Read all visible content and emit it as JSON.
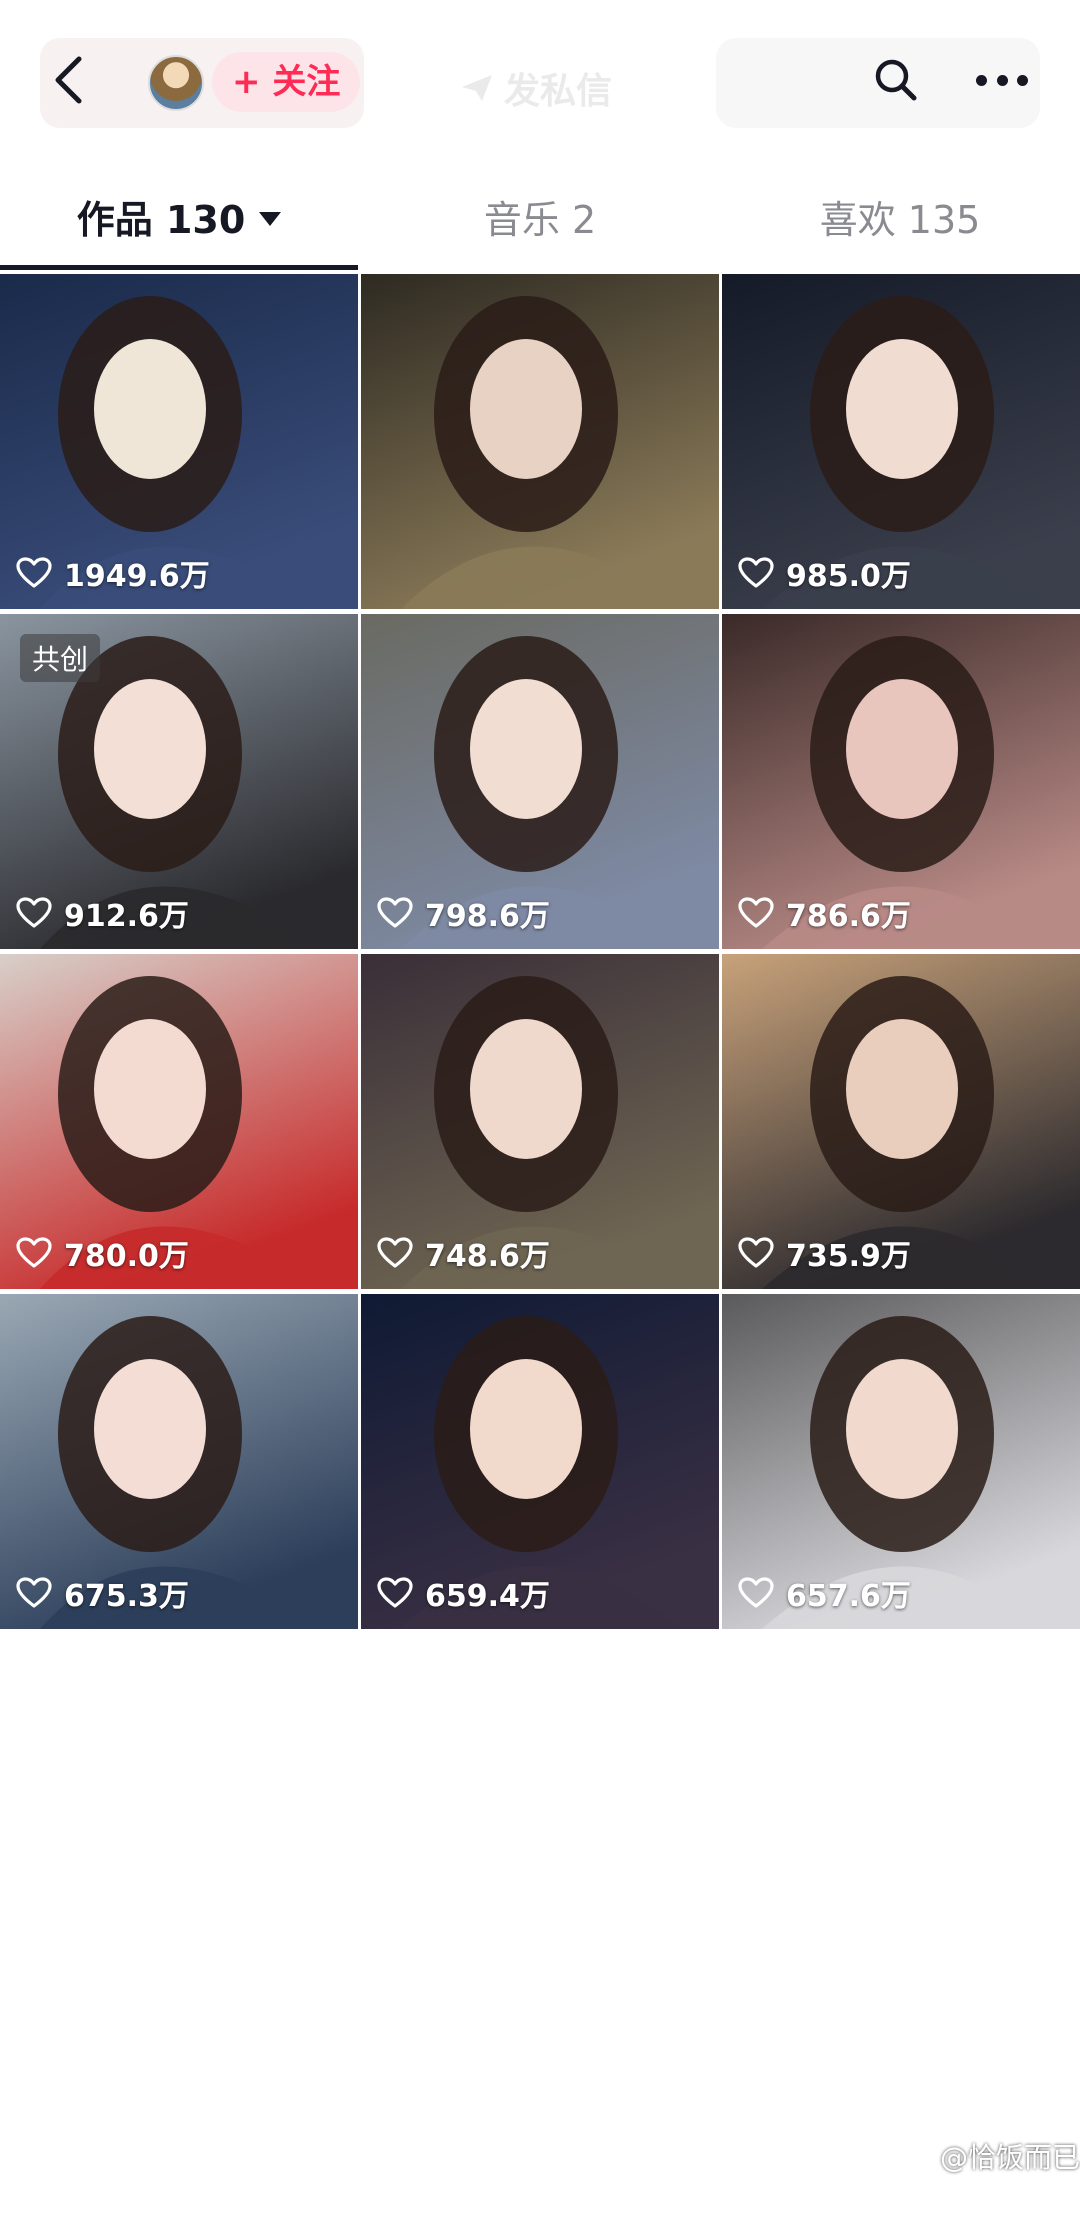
{
  "header": {
    "follow_label": "+ 关注",
    "dm_label": "发私信",
    "icons": [
      "back-arrow-icon",
      "search-icon",
      "more-icon"
    ]
  },
  "tabs": [
    {
      "label": "作品 130",
      "active": true
    },
    {
      "label": "音乐 2",
      "active": false
    },
    {
      "label": "喜欢 135",
      "active": false
    }
  ],
  "videos": [
    {
      "likes": "1949.6万",
      "palette": [
        "#1a2a4a",
        "#3a4d7a",
        "#f0e6d8"
      ]
    },
    {
      "likes": "",
      "palette": [
        "#2e2a22",
        "#8a7a58",
        "#e8d2c4"
      ]
    },
    {
      "likes": "985.0万",
      "palette": [
        "#151a28",
        "#3b3f4c",
        "#f1dcd2"
      ]
    },
    {
      "likes": "912.6万",
      "badge": "共创",
      "palette": [
        "#8a95a0",
        "#2a2a2e",
        "#f4dfd6"
      ]
    },
    {
      "likes": "798.6万",
      "palette": [
        "#6a6a62",
        "#7e8aa4",
        "#f1ddd1"
      ]
    },
    {
      "likes": "786.6万",
      "palette": [
        "#3a2a28",
        "#b88a86",
        "#e9c6bd"
      ]
    },
    {
      "likes": "780.0万",
      "palette": [
        "#d8cfc9",
        "#c72a2a",
        "#f3dbd1"
      ]
    },
    {
      "likes": "748.6万",
      "palette": [
        "#3a2e38",
        "#6e6552",
        "#efd8cc"
      ]
    },
    {
      "likes": "735.9万",
      "palette": [
        "#c8a27a",
        "#2c2a2e",
        "#e9cdbd"
      ]
    },
    {
      "likes": "675.3万",
      "palette": [
        "#9aa8b4",
        "#2c3e5a",
        "#f3ddd4"
      ]
    },
    {
      "likes": "659.4万",
      "palette": [
        "#0f1a34",
        "#3a3044",
        "#f1d9cc"
      ]
    },
    {
      "likes": "657.6万",
      "palette": [
        "#5a5a5c",
        "#d8d8dc",
        "#f2d9cd"
      ]
    }
  ],
  "watermark": "@恰饭而已"
}
